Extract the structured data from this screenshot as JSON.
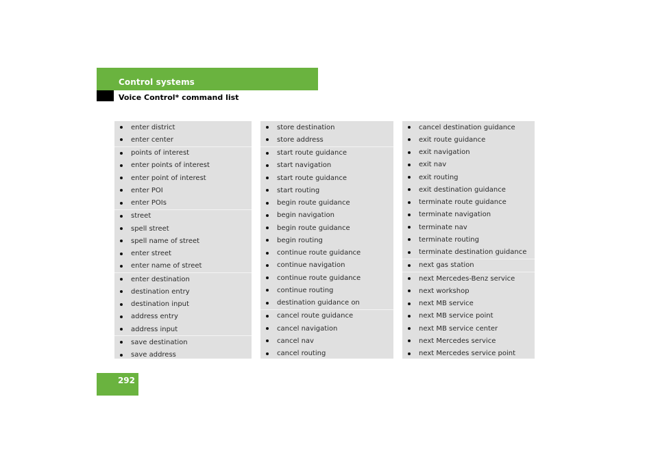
{
  "header": {
    "section_title": "Control systems",
    "subtitle": "Voice Control* command list",
    "accent_color": "#6ab33f"
  },
  "page_number": "292",
  "columns": [
    {
      "groups": [
        {
          "items": [
            "enter district",
            "enter center"
          ]
        },
        {
          "items": [
            "points of interest",
            "enter points of interest",
            "enter point of interest",
            "enter POI",
            "enter POIs"
          ]
        },
        {
          "items": [
            "street",
            "spell street",
            "spell name of street",
            "enter street",
            "enter name of street"
          ]
        },
        {
          "items": [
            "enter destination",
            "destination entry",
            "destination input",
            "address entry",
            "address input"
          ]
        },
        {
          "items": [
            "save destination",
            "save address"
          ]
        }
      ]
    },
    {
      "groups": [
        {
          "items": [
            "store destination",
            "store address"
          ]
        },
        {
          "items": [
            "start route guidance",
            "start navigation",
            "start route guidance",
            "start routing",
            "begin route guidance",
            "begin navigation",
            "begin route guidance",
            "begin routing",
            "continue route guidance",
            "continue navigation",
            "continue route guidance",
            "continue routing",
            "destination guidance on"
          ]
        },
        {
          "items": [
            "cancel route guidance",
            "cancel navigation",
            "cancel nav",
            "cancel routing"
          ]
        }
      ]
    },
    {
      "groups": [
        {
          "items": [
            "cancel destination guidance",
            "exit route guidance",
            "exit navigation",
            "exit nav",
            "exit routing",
            "exit destination guidance",
            "terminate route guidance",
            "terminate navigation",
            "terminate nav",
            "terminate routing",
            "terminate destination guidance"
          ]
        },
        {
          "items": [
            "next gas station"
          ]
        },
        {
          "items": [
            "next Mercedes-Benz service",
            "next workshop",
            "next MB service",
            "next MB service point",
            "next MB service center",
            "next Mercedes service",
            "next Mercedes service point"
          ]
        }
      ]
    }
  ]
}
